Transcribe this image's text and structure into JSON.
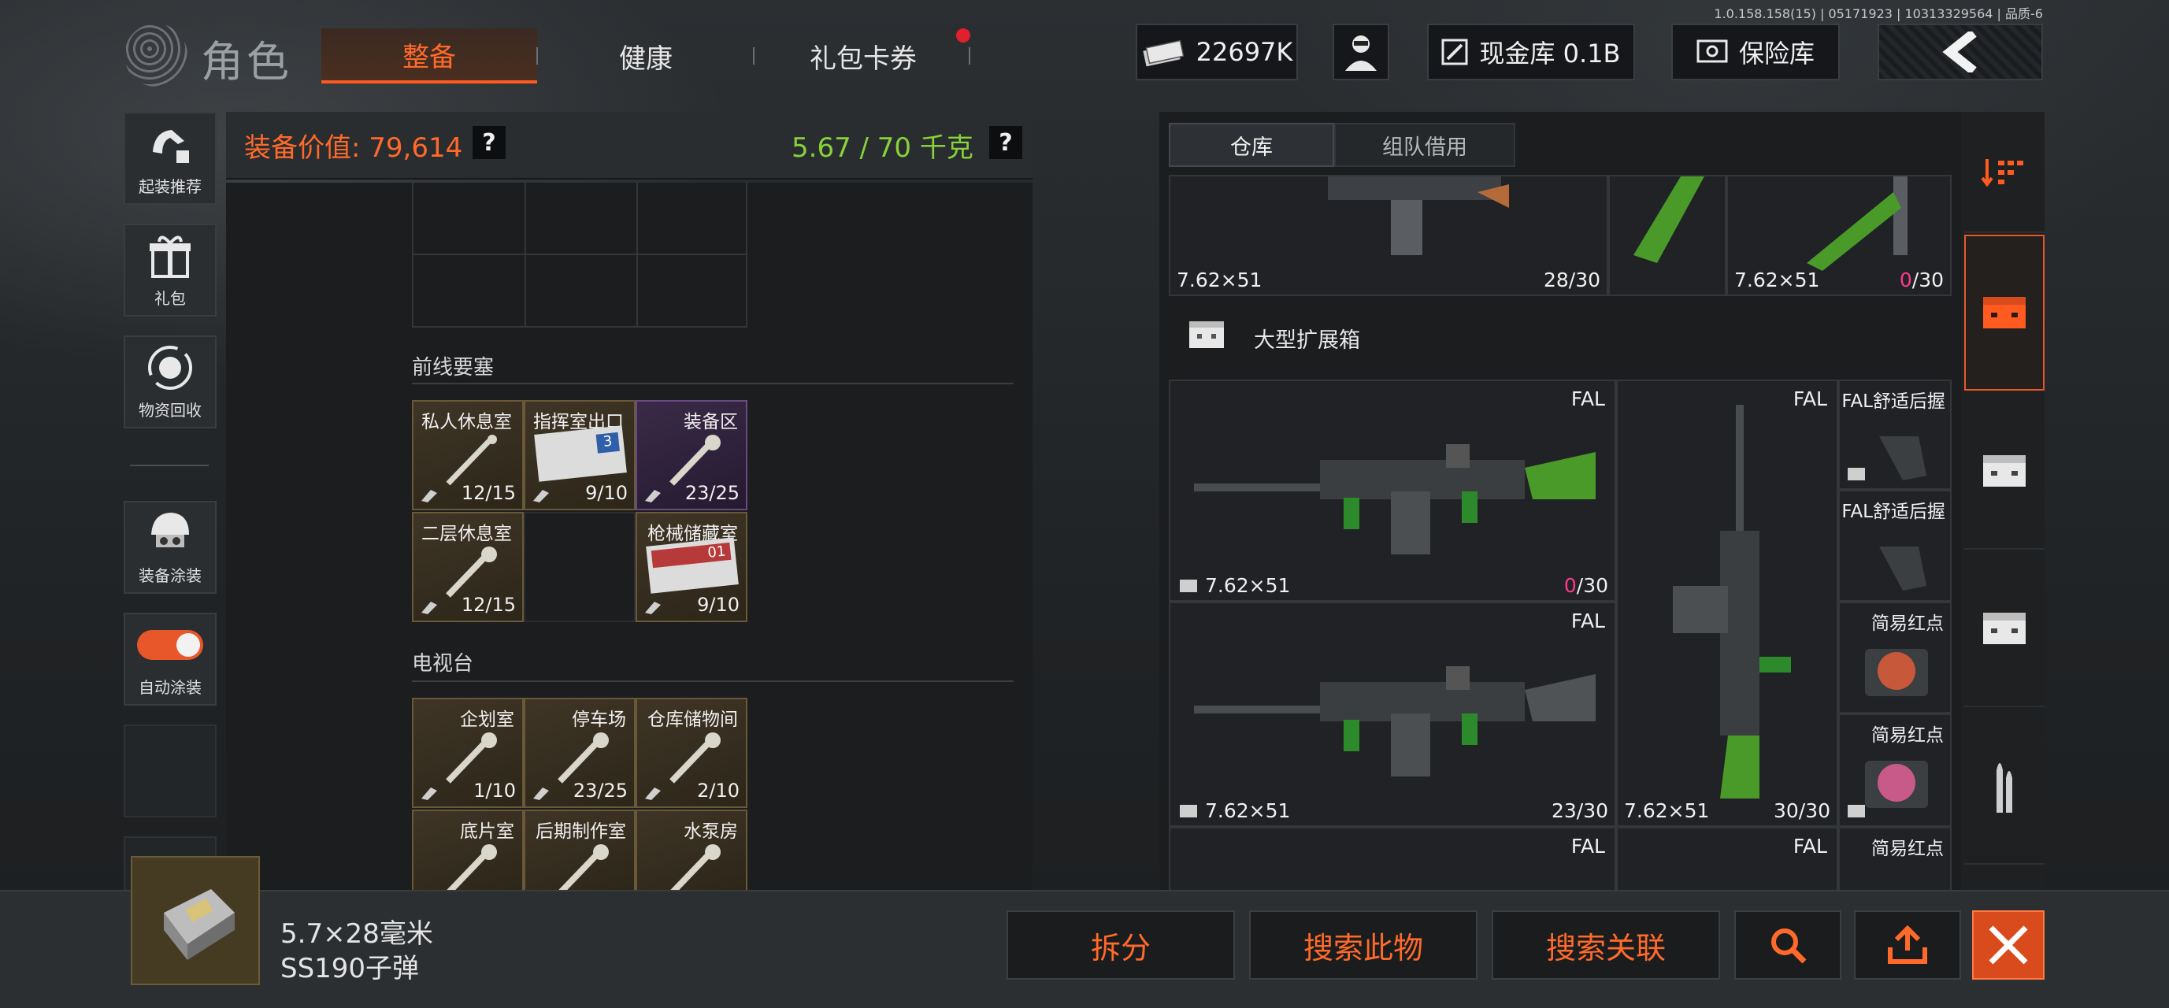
{
  "version": "1.0.158.158(15) | 05171923 | 10313329564 | 品质-6",
  "header": {
    "title": "角色",
    "tabs": [
      {
        "label": "整备",
        "active": true
      },
      {
        "label": "健康",
        "active": false
      },
      {
        "label": "礼包卡券",
        "active": false
      }
    ],
    "currency_value": "22697K",
    "cash_vault_label": "现金库 0.1B",
    "safe_label": "保险库"
  },
  "sidebar": {
    "items": [
      {
        "label": "起装推荐",
        "icon": "loadout-recommend-icon"
      },
      {
        "label": "礼包",
        "icon": "gift-icon"
      },
      {
        "label": "物资回收",
        "icon": "recycle-icon"
      },
      {
        "label": "装备涂装",
        "icon": "helmet-icon"
      },
      {
        "label": "自动涂装",
        "toggle_on": true
      }
    ]
  },
  "equipment": {
    "value_text": "装备价值: 79,614",
    "weight_text": "5.67 / 70 千克",
    "help_symbol": "?"
  },
  "keys": {
    "sections": [
      {
        "title": "前线要塞",
        "cells": [
          {
            "name": "私人休息室",
            "count": "12/15"
          },
          {
            "name": "指挥室出口",
            "count": "9/10"
          },
          {
            "name": "装备区",
            "count": "23/25"
          },
          {
            "name": "二层休息室",
            "count": "12/15"
          },
          {
            "name": "",
            "count": ""
          },
          {
            "name": "枪械储藏室",
            "count": "9/10"
          }
        ]
      },
      {
        "title": "电视台",
        "cells": [
          {
            "name": "企划室",
            "count": "1/10"
          },
          {
            "name": "停车场",
            "count": "23/25"
          },
          {
            "name": "仓库储物间",
            "count": "2/10"
          },
          {
            "name": "底片室",
            "count": ""
          },
          {
            "name": "后期制作室",
            "count": ""
          },
          {
            "name": "水泵房",
            "count": ""
          }
        ]
      }
    ],
    "badge_number": "3",
    "badge_code": "01"
  },
  "warehouse": {
    "tabs": [
      {
        "label": "仓库",
        "active": true
      },
      {
        "label": "组队借用",
        "active": false
      }
    ],
    "top_row": [
      {
        "caliber": "7.62×51",
        "ammo_loaded": "28",
        "ammo_cap": "/30"
      },
      {
        "caliber": "7.62×51",
        "ammo_loaded": "0",
        "ammo_cap": "/30"
      }
    ],
    "container_title": "大型扩展箱",
    "items": [
      {
        "name": "FAL",
        "caliber": "7.62×51",
        "ammo_loaded": "0",
        "ammo_cap": "/30"
      },
      {
        "name": "FAL",
        "caliber": "7.62×51",
        "ammo_loaded": "30",
        "ammo_cap": "/30"
      },
      {
        "name": "FAL舒适后握"
      },
      {
        "name": "FAL舒适后握"
      },
      {
        "name": "FAL",
        "caliber": "7.62×51",
        "ammo_loaded": "23",
        "ammo_cap": "/30"
      },
      {
        "name": "简易红点"
      },
      {
        "name": "简易红点"
      },
      {
        "name": "FAL"
      },
      {
        "name": "FAL"
      },
      {
        "name": "简易红点"
      }
    ]
  },
  "selected_item": {
    "line1": "5.7×28毫米",
    "line2": "SS190子弹"
  },
  "actions": {
    "split": "拆分",
    "search_item": "搜索此物",
    "search_related": "搜索关联"
  },
  "colors": {
    "accent": "#ff6a2a",
    "weight_green": "#87d23a",
    "ammo_empty_pink": "#ff3a8c",
    "notify_red": "#e0202c"
  }
}
